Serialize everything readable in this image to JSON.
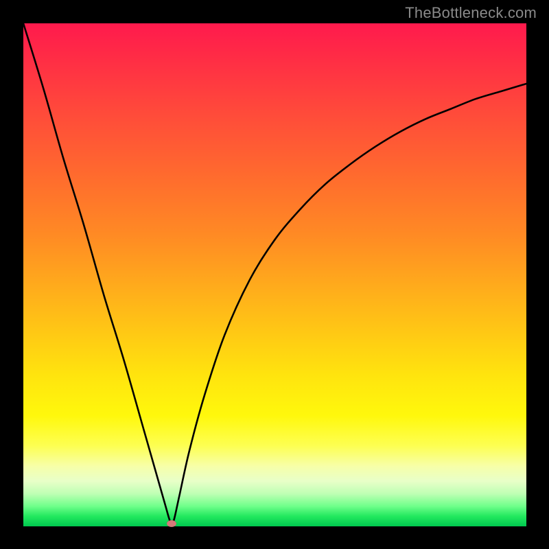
{
  "watermark": "TheBottleneck.com",
  "chart_data": {
    "type": "line",
    "title": "",
    "xlabel": "",
    "ylabel": "",
    "xlim": [
      0,
      100
    ],
    "ylim": [
      0,
      100
    ],
    "series": [
      {
        "name": "curve",
        "x": [
          0,
          4,
          8,
          12,
          16,
          20,
          24,
          28,
          29,
          29.5,
          30,
          31,
          33,
          36,
          40,
          45,
          50,
          55,
          60,
          65,
          70,
          75,
          80,
          85,
          90,
          95,
          100
        ],
        "y": [
          100,
          87,
          73,
          60,
          46,
          33,
          19,
          5,
          1.5,
          0.5,
          1.5,
          6,
          15,
          26,
          38,
          49,
          57,
          63,
          68,
          72,
          75.5,
          78.5,
          81,
          83,
          85,
          86.5,
          88
        ]
      }
    ],
    "marker": {
      "x": 29.5,
      "y": 0.5,
      "color": "#d77a7a"
    },
    "background_gradient": {
      "top": "#ff1a4d",
      "upper_mid": "#ff8a24",
      "mid": "#ffe40e",
      "lower_mid": "#f7ffa8",
      "bottom": "#00c94f"
    }
  }
}
